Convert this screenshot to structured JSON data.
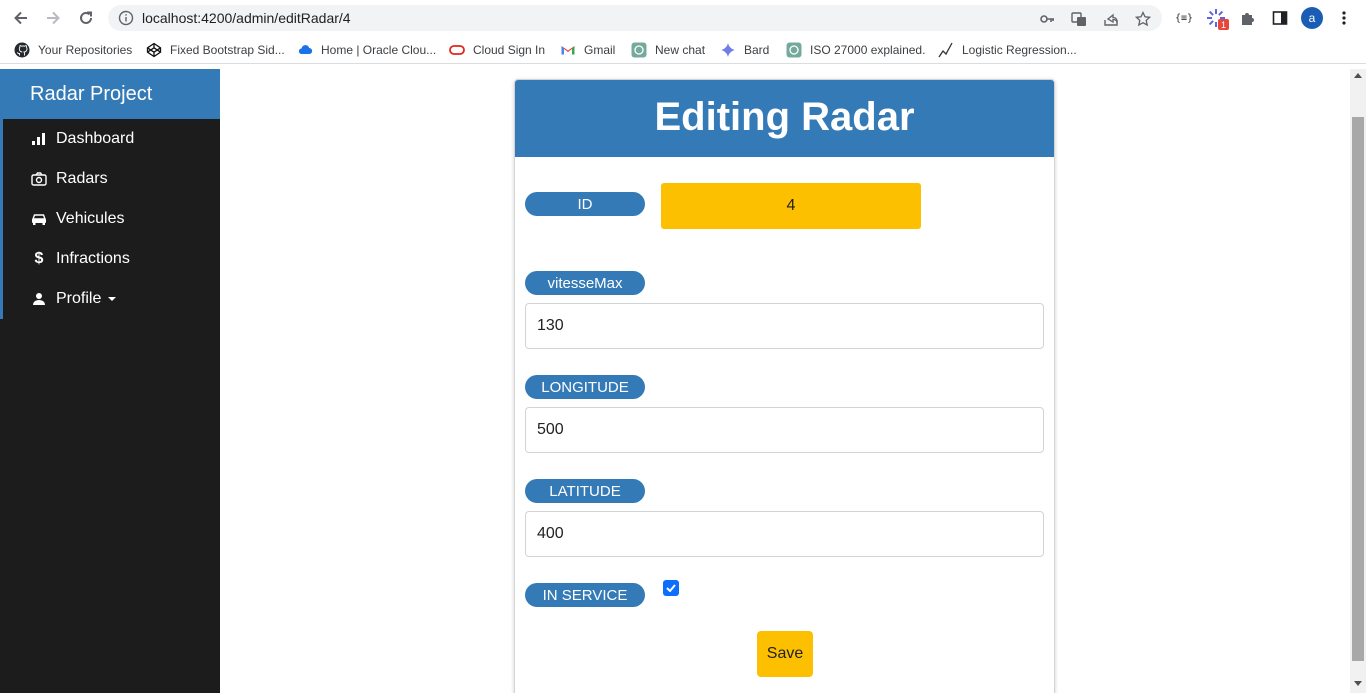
{
  "browser": {
    "url": "localhost:4200/admin/editRadar/4",
    "avatar_letter": "a",
    "extension_badge": "1",
    "json_ext_label": "{≡}"
  },
  "bookmarks": [
    {
      "label": "Your Repositories",
      "icon": "github-icon"
    },
    {
      "label": "Fixed Bootstrap Sid...",
      "icon": "codepen-icon"
    },
    {
      "label": "Home | Oracle Clou...",
      "icon": "cloud-icon"
    },
    {
      "label": "Cloud Sign In",
      "icon": "oracle-icon"
    },
    {
      "label": "Gmail",
      "icon": "gmail-icon"
    },
    {
      "label": "New chat",
      "icon": "chatgpt-icon"
    },
    {
      "label": "Bard",
      "icon": "bard-icon"
    },
    {
      "label": "ISO 27000 explained.",
      "icon": "chatgpt-icon"
    },
    {
      "label": "Logistic Regression...",
      "icon": "chart-line-icon"
    }
  ],
  "sidebar": {
    "brand": "Radar Project",
    "items": [
      {
        "label": "Dashboard",
        "icon": "bar-chart-icon"
      },
      {
        "label": "Radars",
        "icon": "camera-icon"
      },
      {
        "label": "Vehicules",
        "icon": "car-icon"
      },
      {
        "label": "Infractions",
        "icon": "dollar-icon"
      },
      {
        "label": "Profile",
        "icon": "user-icon"
      }
    ]
  },
  "form": {
    "title": "Editing Radar",
    "id_label": "ID",
    "id_value": "4",
    "vitesse_label": "vitesseMax",
    "vitesse_value": "130",
    "longitude_label": "LONGITUDE",
    "longitude_value": "500",
    "latitude_label": "LATITUDE",
    "latitude_value": "400",
    "in_service_label": "IN SERVICE",
    "in_service_checked": true,
    "save_label": "Save"
  },
  "colors": {
    "primary": "#337ab7",
    "accent": "#fcc000",
    "sidebar_bg": "#1c1c1c",
    "checkbox": "#0d6efd"
  }
}
